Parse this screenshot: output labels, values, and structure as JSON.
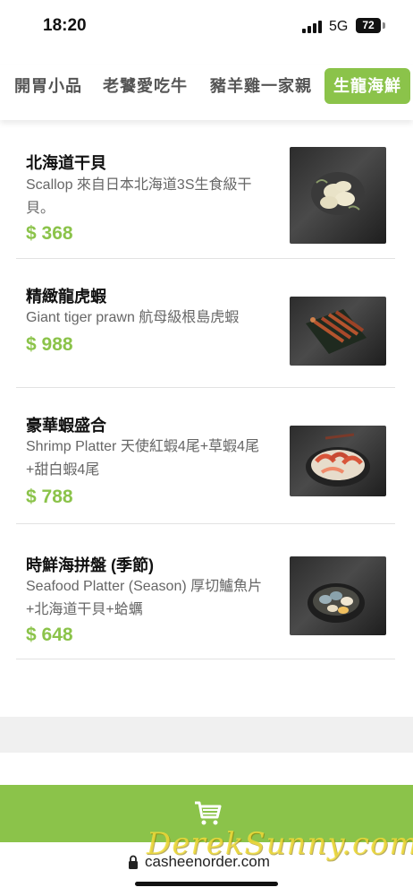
{
  "status_bar": {
    "time": "18:20",
    "network": "5G",
    "battery": "72"
  },
  "tabs": [
    {
      "label": "開胃小品"
    },
    {
      "label": "老饕愛吃牛"
    },
    {
      "label": "豬羊雞一家親"
    },
    {
      "label": "生龍海鮮",
      "active": true
    }
  ],
  "items": [
    {
      "name": "北海道干貝",
      "desc": "Scallop 來自日本北海道3S生食級干貝。",
      "price": "$ 368",
      "image": "scallop-photo"
    },
    {
      "name": "精緻龍虎蝦",
      "desc": "Giant tiger prawn 航母級根島虎蝦",
      "price": "$ 988",
      "image": "tiger-prawn-photo"
    },
    {
      "name": "豪華蝦盛合",
      "desc": "Shrimp Platter 天使紅蝦4尾+草蝦4尾+甜白蝦4尾",
      "price": "$ 788",
      "image": "shrimp-platter-photo"
    },
    {
      "name": "時鮮海拼盤 (季節)",
      "desc": "Seafood Platter (Season) 厚切鱸魚片+北海道干貝+蛤蠣",
      "price": "$ 648",
      "image": "seafood-platter-photo"
    }
  ],
  "cart": {
    "icon": "cart-icon"
  },
  "url": {
    "text": "casheenorder.com"
  },
  "watermark": "DerekSunny.com",
  "colors": {
    "accent": "#8bc34a",
    "tab_text": "#555555",
    "desc_text": "#666666"
  }
}
